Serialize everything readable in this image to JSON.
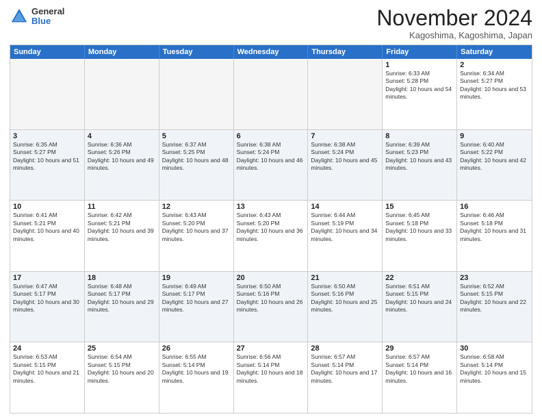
{
  "logo": {
    "general": "General",
    "blue": "Blue"
  },
  "header": {
    "month": "November 2024",
    "location": "Kagoshima, Kagoshima, Japan"
  },
  "weekdays": [
    "Sunday",
    "Monday",
    "Tuesday",
    "Wednesday",
    "Thursday",
    "Friday",
    "Saturday"
  ],
  "rows": [
    [
      {
        "day": "",
        "empty": true
      },
      {
        "day": "",
        "empty": true
      },
      {
        "day": "",
        "empty": true
      },
      {
        "day": "",
        "empty": true
      },
      {
        "day": "",
        "empty": true
      },
      {
        "day": "1",
        "info": "Sunrise: 6:33 AM\nSunset: 5:28 PM\nDaylight: 10 hours and 54 minutes."
      },
      {
        "day": "2",
        "info": "Sunrise: 6:34 AM\nSunset: 5:27 PM\nDaylight: 10 hours and 53 minutes."
      }
    ],
    [
      {
        "day": "3",
        "info": "Sunrise: 6:35 AM\nSunset: 5:27 PM\nDaylight: 10 hours and 51 minutes."
      },
      {
        "day": "4",
        "info": "Sunrise: 6:36 AM\nSunset: 5:26 PM\nDaylight: 10 hours and 49 minutes."
      },
      {
        "day": "5",
        "info": "Sunrise: 6:37 AM\nSunset: 5:25 PM\nDaylight: 10 hours and 48 minutes."
      },
      {
        "day": "6",
        "info": "Sunrise: 6:38 AM\nSunset: 5:24 PM\nDaylight: 10 hours and 46 minutes."
      },
      {
        "day": "7",
        "info": "Sunrise: 6:38 AM\nSunset: 5:24 PM\nDaylight: 10 hours and 45 minutes."
      },
      {
        "day": "8",
        "info": "Sunrise: 6:39 AM\nSunset: 5:23 PM\nDaylight: 10 hours and 43 minutes."
      },
      {
        "day": "9",
        "info": "Sunrise: 6:40 AM\nSunset: 5:22 PM\nDaylight: 10 hours and 42 minutes."
      }
    ],
    [
      {
        "day": "10",
        "info": "Sunrise: 6:41 AM\nSunset: 5:21 PM\nDaylight: 10 hours and 40 minutes."
      },
      {
        "day": "11",
        "info": "Sunrise: 6:42 AM\nSunset: 5:21 PM\nDaylight: 10 hours and 39 minutes."
      },
      {
        "day": "12",
        "info": "Sunrise: 6:43 AM\nSunset: 5:20 PM\nDaylight: 10 hours and 37 minutes."
      },
      {
        "day": "13",
        "info": "Sunrise: 6:43 AM\nSunset: 5:20 PM\nDaylight: 10 hours and 36 minutes."
      },
      {
        "day": "14",
        "info": "Sunrise: 6:44 AM\nSunset: 5:19 PM\nDaylight: 10 hours and 34 minutes."
      },
      {
        "day": "15",
        "info": "Sunrise: 6:45 AM\nSunset: 5:18 PM\nDaylight: 10 hours and 33 minutes."
      },
      {
        "day": "16",
        "info": "Sunrise: 6:46 AM\nSunset: 5:18 PM\nDaylight: 10 hours and 31 minutes."
      }
    ],
    [
      {
        "day": "17",
        "info": "Sunrise: 6:47 AM\nSunset: 5:17 PM\nDaylight: 10 hours and 30 minutes."
      },
      {
        "day": "18",
        "info": "Sunrise: 6:48 AM\nSunset: 5:17 PM\nDaylight: 10 hours and 29 minutes."
      },
      {
        "day": "19",
        "info": "Sunrise: 6:49 AM\nSunset: 5:17 PM\nDaylight: 10 hours and 27 minutes."
      },
      {
        "day": "20",
        "info": "Sunrise: 6:50 AM\nSunset: 5:16 PM\nDaylight: 10 hours and 26 minutes."
      },
      {
        "day": "21",
        "info": "Sunrise: 6:50 AM\nSunset: 5:16 PM\nDaylight: 10 hours and 25 minutes."
      },
      {
        "day": "22",
        "info": "Sunrise: 6:51 AM\nSunset: 5:15 PM\nDaylight: 10 hours and 24 minutes."
      },
      {
        "day": "23",
        "info": "Sunrise: 6:52 AM\nSunset: 5:15 PM\nDaylight: 10 hours and 22 minutes."
      }
    ],
    [
      {
        "day": "24",
        "info": "Sunrise: 6:53 AM\nSunset: 5:15 PM\nDaylight: 10 hours and 21 minutes."
      },
      {
        "day": "25",
        "info": "Sunrise: 6:54 AM\nSunset: 5:15 PM\nDaylight: 10 hours and 20 minutes."
      },
      {
        "day": "26",
        "info": "Sunrise: 6:55 AM\nSunset: 5:14 PM\nDaylight: 10 hours and 19 minutes."
      },
      {
        "day": "27",
        "info": "Sunrise: 6:56 AM\nSunset: 5:14 PM\nDaylight: 10 hours and 18 minutes."
      },
      {
        "day": "28",
        "info": "Sunrise: 6:57 AM\nSunset: 5:14 PM\nDaylight: 10 hours and 17 minutes."
      },
      {
        "day": "29",
        "info": "Sunrise: 6:57 AM\nSunset: 5:14 PM\nDaylight: 10 hours and 16 minutes."
      },
      {
        "day": "30",
        "info": "Sunrise: 6:58 AM\nSunset: 5:14 PM\nDaylight: 10 hours and 15 minutes."
      }
    ]
  ]
}
